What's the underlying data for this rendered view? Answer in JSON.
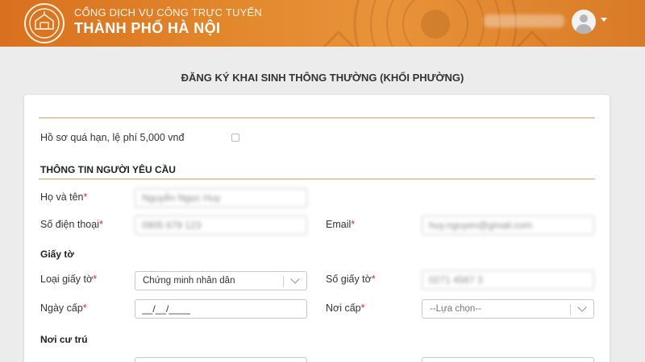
{
  "header": {
    "portal_subtitle": "CỔNG DỊCH VỤ CÔNG TRỰC TUYẾN",
    "portal_title": "THÀNH PHỐ HÀ NỘI"
  },
  "page": {
    "title": "ĐĂNG KÝ KHAI SINH THÔNG THƯỜNG (KHỐI PHƯỜNG)"
  },
  "form": {
    "overdue_label": "Hồ sơ quá hạn, lệ phí 5,000 vnđ",
    "requester_section": "THÔNG TIN NGƯỜI YÊU CẦU",
    "full_name_label": "Họ và tên",
    "full_name_value": "Nguyễn Ngọc Huy",
    "phone_label": "Số điện thoại",
    "phone_value": "0905 679 123",
    "email_label": "Email",
    "email_value": "huy.nguyen@gmail.com",
    "documents_section": "Giấy tờ",
    "doc_type_label": "Loại giấy tờ",
    "doc_type_value": "Chứng minh nhân dân",
    "doc_number_label": "Số giấy tờ",
    "doc_number_value": "0271 4567 3",
    "issue_date_label": "Ngày cấp",
    "issue_date_value": "__/__/____",
    "issue_place_label": "Nơi cấp",
    "issue_place_value": "--Lựa chọn--",
    "residence_section": "Nơi cư trú",
    "required_mark": "*"
  },
  "colors": {
    "header_orange": "#e2872c",
    "accent_rule": "#ec9b5b",
    "required_red": "#d12c2c"
  },
  "icons": {
    "logo": "hanoi-emblem-icon",
    "avatar": "user-avatar-icon",
    "dropdown": "chevron-down-icon"
  }
}
